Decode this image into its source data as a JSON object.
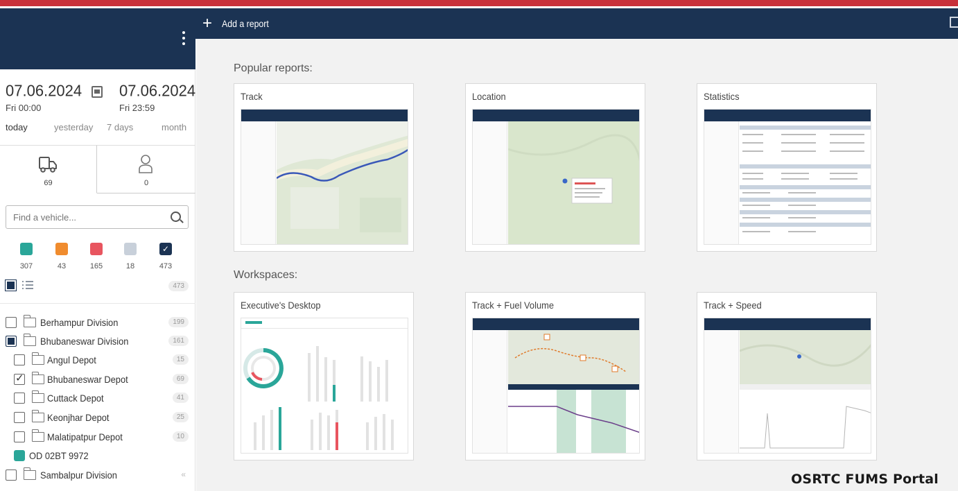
{
  "header": {
    "add_report_label": "Add a report"
  },
  "date_range": {
    "from_date": "07.06.2024",
    "from_sub": "Fri 00:00",
    "to_date": "07.06.2024",
    "to_sub": "Fri 23:59",
    "quick_ranges": [
      "today",
      "yesterday",
      "7 days",
      "month"
    ]
  },
  "tabs": [
    {
      "icon": "truck-icon",
      "count": "69"
    },
    {
      "icon": "driver-icon",
      "count": "0"
    }
  ],
  "search": {
    "placeholder": "Find a vehicle..."
  },
  "statuses": [
    {
      "color": "#2aa699",
      "count": "307"
    },
    {
      "color": "#f08c2e",
      "count": "43"
    },
    {
      "color": "#e8555f",
      "count": "165"
    },
    {
      "color": "#c8d0da",
      "count": "18"
    },
    {
      "color": "#1b3353",
      "count": "473",
      "checked": true
    }
  ],
  "list_total": "473",
  "tree": [
    {
      "label": "Berhampur Division",
      "count": "199",
      "level": 0,
      "check": "empty",
      "type": "folder"
    },
    {
      "label": "Bhubaneswar Division",
      "count": "161",
      "level": 0,
      "check": "partial",
      "type": "folder"
    },
    {
      "label": "Angul Depot",
      "count": "15",
      "level": 1,
      "check": "empty",
      "type": "folder"
    },
    {
      "label": "Bhubaneswar Depot",
      "count": "69",
      "level": 1,
      "check": "checked",
      "type": "folder"
    },
    {
      "label": "Cuttack Depot",
      "count": "41",
      "level": 1,
      "check": "empty",
      "type": "folder"
    },
    {
      "label": "Keonjhar Depot",
      "count": "25",
      "level": 1,
      "check": "empty",
      "type": "folder"
    },
    {
      "label": "Malatipatpur Depot",
      "count": "10",
      "level": 1,
      "check": "empty",
      "type": "folder"
    },
    {
      "label": "OD 02BT 9972",
      "count": "",
      "level": 1,
      "check": "vehicle",
      "type": "vehicle"
    },
    {
      "label": "Sambalpur Division",
      "count": "",
      "level": 0,
      "check": "empty",
      "type": "folder"
    }
  ],
  "popular_reports": {
    "title": "Popular reports:",
    "cards": [
      {
        "title": "Track",
        "kind": "track"
      },
      {
        "title": "Location",
        "kind": "location"
      },
      {
        "title": "Statistics",
        "kind": "statistics"
      }
    ]
  },
  "workspaces": {
    "title": "Workspaces:",
    "cards": [
      {
        "title": "Executive's Desktop",
        "kind": "desktop"
      },
      {
        "title": "Track + Fuel Volume",
        "kind": "fuel"
      },
      {
        "title": "Track + Speed",
        "kind": "speed"
      }
    ]
  },
  "watermark": "OSRTC FUMS Portal"
}
